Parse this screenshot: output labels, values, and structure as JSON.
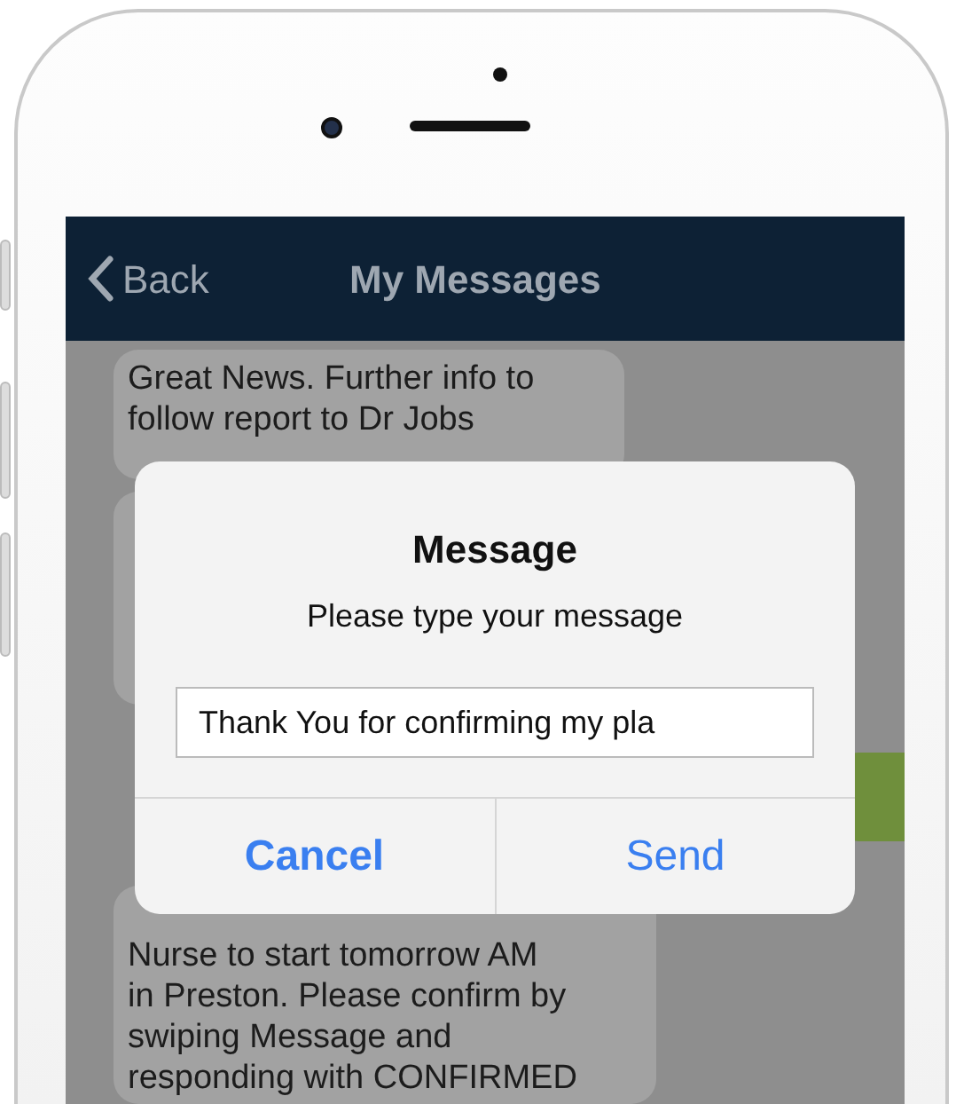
{
  "navbar": {
    "back": "Back",
    "title": "My Messages"
  },
  "messages": [
    {
      "kind": "received",
      "lines": [
        "Great News. Further info to",
        "follow report to Dr Jobs"
      ]
    },
    {
      "kind": "received"
    },
    {
      "kind": "sent"
    },
    {
      "kind": "received",
      "lines": [
        "Nurse to start tomorrow AM",
        "in Preston. Please confirm by",
        "swiping Message and",
        "responding with CONFIRMED"
      ]
    }
  ],
  "dialog": {
    "title": "Message",
    "subtitle": "Please type your message",
    "input_value": "Thank You for confirming my pla",
    "buttons": [
      {
        "label": "Cancel",
        "kind": "cancel"
      },
      {
        "label": "Send",
        "kind": "default"
      }
    ]
  }
}
